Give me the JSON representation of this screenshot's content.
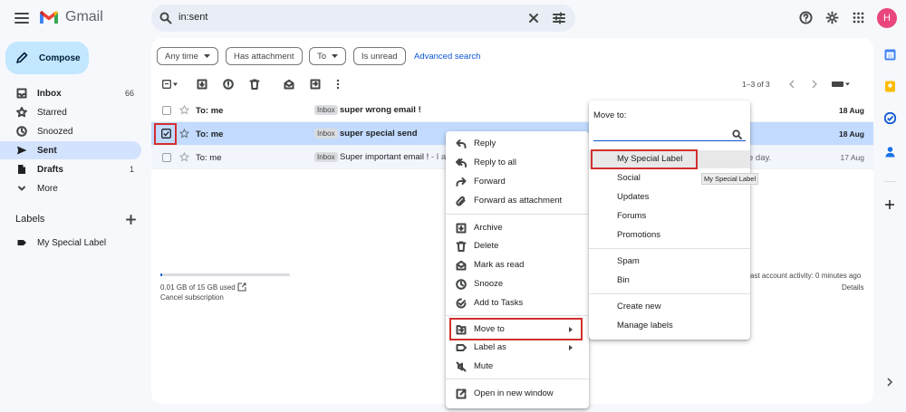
{
  "app": {
    "name": "Gmail",
    "avatar_letter": "H"
  },
  "search": {
    "query": "in:sent"
  },
  "compose_label": "Compose",
  "nav": [
    {
      "label": "Inbox",
      "count": "66",
      "bold": true
    },
    {
      "label": "Starred",
      "count": ""
    },
    {
      "label": "Snoozed",
      "count": ""
    },
    {
      "label": "Sent",
      "count": "",
      "active": true
    },
    {
      "label": "Drafts",
      "count": "1",
      "bold": true
    },
    {
      "label": "More",
      "count": ""
    }
  ],
  "labels": {
    "title": "Labels",
    "items": [
      "My Special Label"
    ]
  },
  "filters": {
    "any_time": "Any time",
    "has_attachment": "Has attachment",
    "to": "To",
    "is_unread": "Is unread",
    "advanced": "Advanced search"
  },
  "pagination": "1–3 of 3",
  "emails": [
    {
      "to": "To: me",
      "tag": "Inbox",
      "subject": "super wrong email !",
      "snippet": "",
      "date": "18 Aug",
      "bold": true
    },
    {
      "to": "To: me",
      "tag": "Inbox",
      "subject": "super special send",
      "snippet": "",
      "date": "18 Aug",
      "bold": true,
      "selected": true
    },
    {
      "to": "To: me",
      "tag": "Inbox",
      "subject": "Super important email !",
      "snippet": " - I a",
      "date": "17 Aug",
      "bold": false
    }
  ],
  "storage": {
    "used": "0.01 GB of 15 GB used",
    "cancel": "Cancel subscription",
    "fraction": 0.001
  },
  "activity": {
    "text": "ast account activity: 0 minutes ago",
    "details": "Details",
    "partial_day": "e day."
  },
  "context_menu": {
    "items": [
      {
        "label": "Reply",
        "icon": "reply-icon"
      },
      {
        "label": "Reply to all",
        "icon": "reply-all-icon"
      },
      {
        "label": "Forward",
        "icon": "forward-icon"
      },
      {
        "label": "Forward as attachment",
        "icon": "attachment-icon"
      },
      {
        "label": "Archive",
        "icon": "archive-icon"
      },
      {
        "label": "Delete",
        "icon": "trash-icon"
      },
      {
        "label": "Mark as read",
        "icon": "envelope-open-icon"
      },
      {
        "label": "Snooze",
        "icon": "clock-icon"
      },
      {
        "label": "Add to Tasks",
        "icon": "add-task-icon"
      },
      {
        "label": "Move to",
        "icon": "move-to-icon"
      },
      {
        "label": "Label as",
        "icon": "label-icon"
      },
      {
        "label": "Mute",
        "icon": "mute-icon"
      },
      {
        "label": "Open in new window",
        "icon": "open-new-window-icon"
      }
    ]
  },
  "move_to": {
    "title": "Move to:",
    "items": [
      "My Special Label",
      "Social",
      "Updates",
      "Forums",
      "Promotions",
      "Spam",
      "Bin",
      "Create new",
      "Manage labels"
    ],
    "tooltip": "My Special Label"
  }
}
